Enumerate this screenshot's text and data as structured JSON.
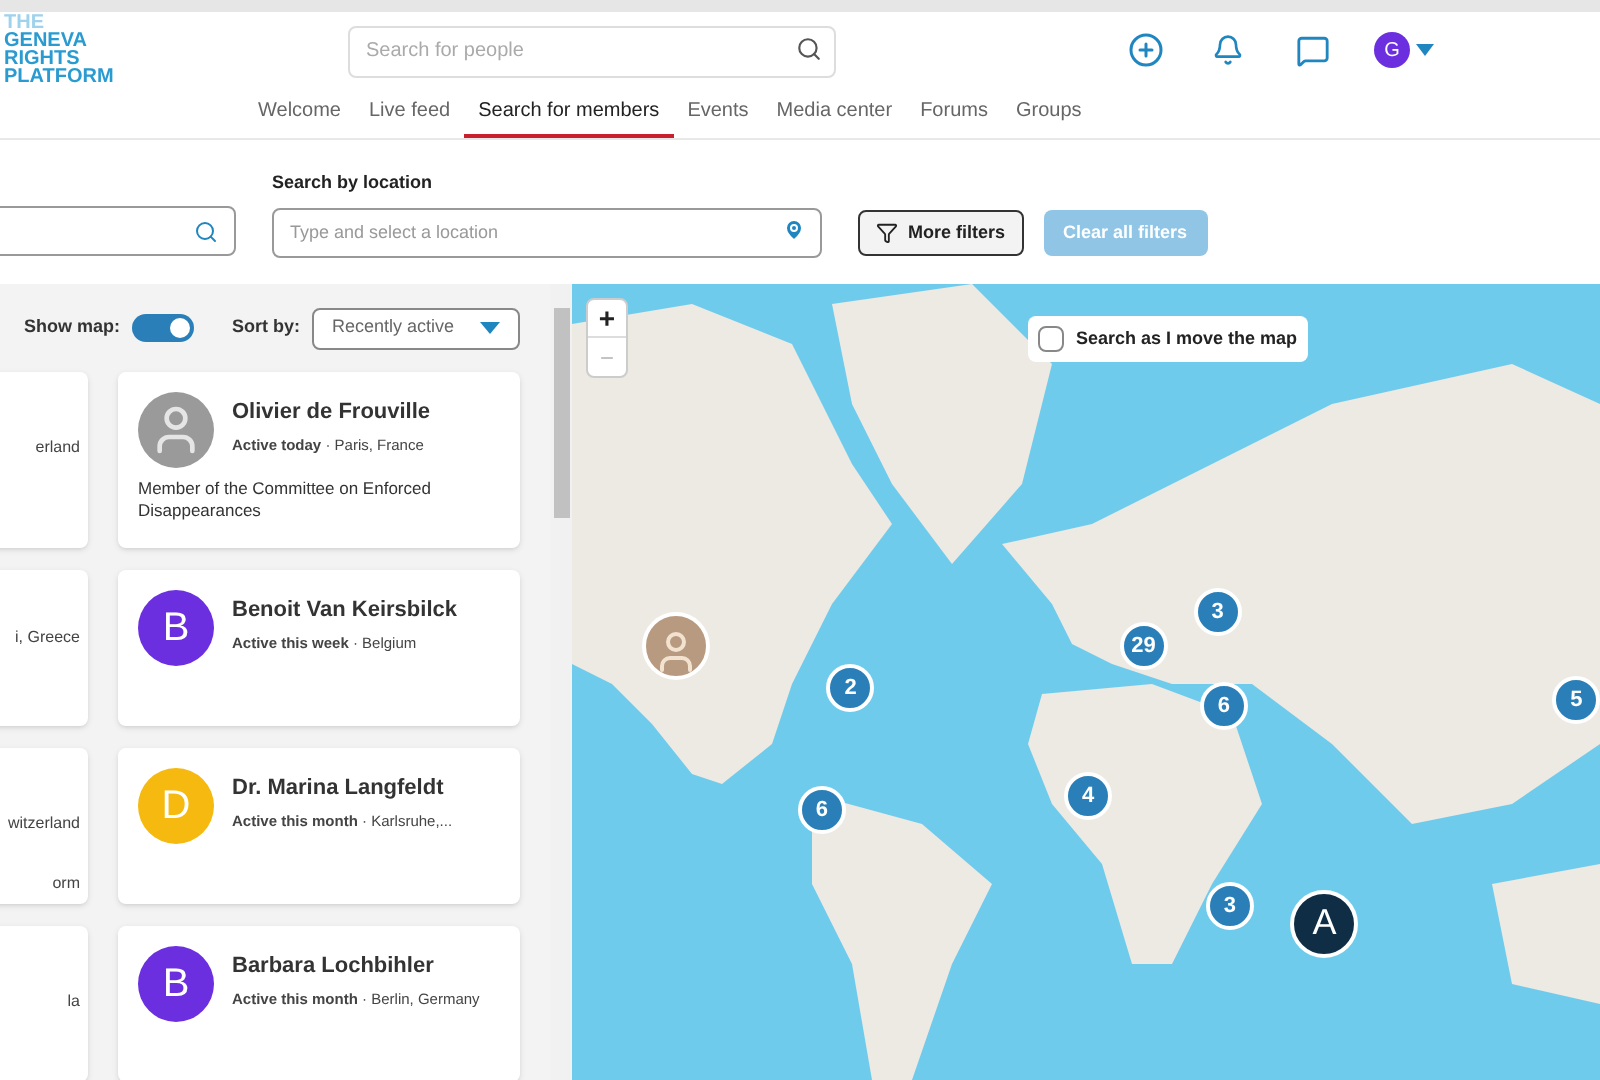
{
  "logo": {
    "lines": [
      "THE",
      "GENEVA",
      "RIGHTS",
      "PLATFORM"
    ]
  },
  "header": {
    "search_placeholder": "Search for people",
    "avatar_letter": "G"
  },
  "nav": [
    {
      "label": "Welcome",
      "selected": false
    },
    {
      "label": "Live feed",
      "selected": false
    },
    {
      "label": "Search for members",
      "selected": true
    },
    {
      "label": "Events",
      "selected": false
    },
    {
      "label": "Media center",
      "selected": false
    },
    {
      "label": "Forums",
      "selected": false
    },
    {
      "label": "Groups",
      "selected": false
    }
  ],
  "filters": {
    "location_label": "Search by location",
    "location_placeholder": "Type and select a location",
    "more_filters": "More filters",
    "clear_filters": "Clear all filters"
  },
  "list_controls": {
    "show_map_label": "Show map:",
    "show_map_on": true,
    "sort_label": "Sort by:",
    "sort_value": "Recently active"
  },
  "cut_cards": [
    {
      "line_1": "erland"
    },
    {
      "line_1": "i, Greece"
    },
    {
      "line_1": "witzerland",
      "line_2": "orm"
    },
    {
      "line_1": "la"
    }
  ],
  "members": [
    {
      "name": "Olivier de Frouville",
      "activity": "Active today",
      "separator": "·",
      "location": "Paris, France",
      "bio": "Member of the Committee on Enforced Disappearances",
      "avatar": {
        "kind": "photo"
      }
    },
    {
      "name": "Benoit Van Keirsbilck",
      "activity": "Active this week",
      "separator": "·",
      "location": "Belgium",
      "avatar": {
        "kind": "letter",
        "letter": "B",
        "color": "#6b2fe0"
      }
    },
    {
      "name": "Dr. Marina Langfeldt",
      "activity": "Active this month",
      "separator": "·",
      "location": "Karlsruhe,...",
      "avatar": {
        "kind": "letter",
        "letter": "D",
        "color": "#f5b90f"
      }
    },
    {
      "name": "Barbara Lochbihler",
      "activity": "Active this month",
      "separator": "·",
      "location": "Berlin, Germany",
      "avatar": {
        "kind": "letter",
        "letter": "B",
        "color": "#6b2fe0"
      }
    }
  ],
  "map": {
    "zoom_in": "+",
    "zoom_out": "−",
    "search_as_move": {
      "label": "Search as I move the map",
      "checked": false
    },
    "markers": [
      {
        "kind": "photo"
      },
      {
        "kind": "cluster",
        "label": "2"
      },
      {
        "kind": "cluster",
        "label": "29"
      },
      {
        "kind": "cluster",
        "label": "3"
      },
      {
        "kind": "cluster",
        "label": "6"
      },
      {
        "kind": "cluster",
        "label": "4"
      },
      {
        "kind": "cluster",
        "label": "6"
      },
      {
        "kind": "cluster",
        "label": "3"
      },
      {
        "kind": "cluster",
        "label": "5"
      },
      {
        "kind": "letter",
        "label": "A"
      }
    ]
  }
}
